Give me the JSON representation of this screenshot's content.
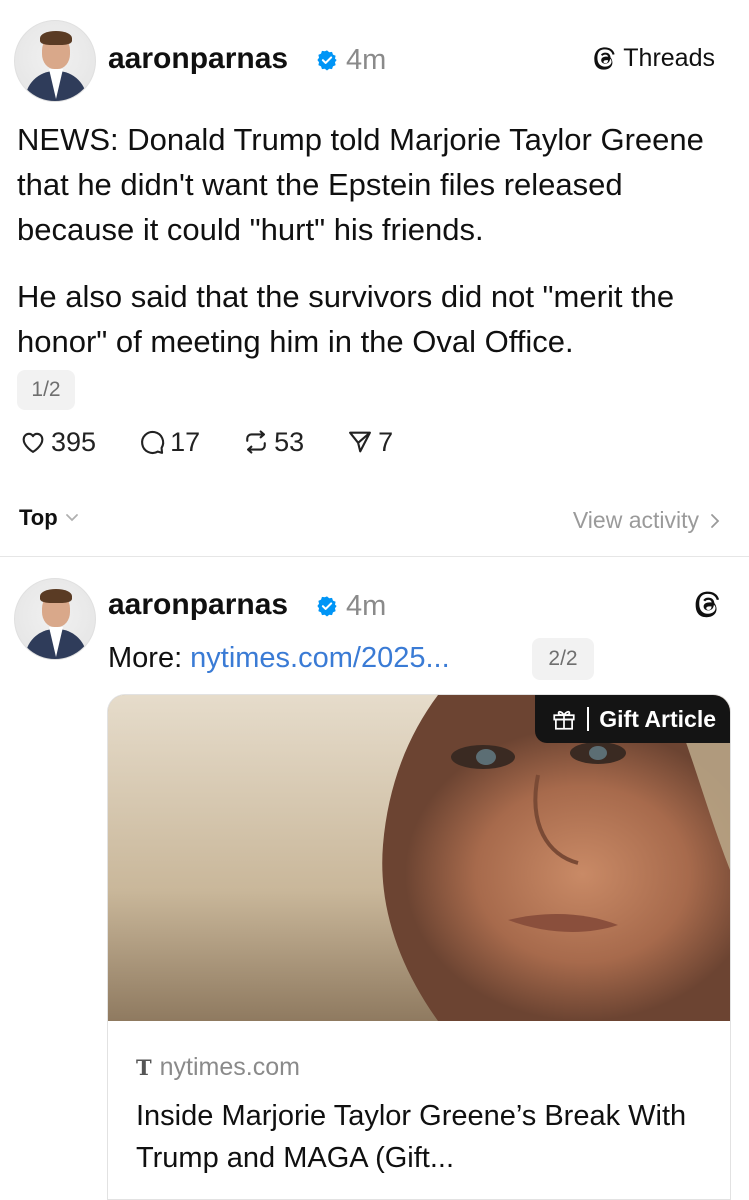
{
  "post1": {
    "username": "aaronparnas",
    "time": "4m",
    "platform_label": "Threads",
    "paragraphs": [
      "NEWS: Donald Trump told Marjorie Taylor Greene that he didn't want the Epstein files released because it could \"hurt\" his friends.",
      "He also said that the survivors did not \"merit the honor\" of meeting him in the Oval Office."
    ],
    "pager": "1/2",
    "actions": {
      "likes": "395",
      "replies": "17",
      "reposts": "53",
      "shares": "7"
    }
  },
  "sort": {
    "label": "Top",
    "view_activity": "View activity"
  },
  "post2": {
    "username": "aaronparnas",
    "time": "4m",
    "more_label": "More:",
    "link_text": "nytimes.com/2025...",
    "pager": "2/2",
    "card": {
      "gift_label": "Gift Article",
      "source_icon": "T",
      "domain": "nytimes.com",
      "title": "Inside Marjorie Taylor Greene’s Break With Trump and MAGA (Gift..."
    }
  },
  "icons": {
    "verified": "verified-badge-icon",
    "like": "heart-icon",
    "reply": "comment-icon",
    "repost": "repost-icon",
    "share": "send-icon",
    "threads": "threads-logo-icon",
    "gift": "gift-icon"
  },
  "colors": {
    "text": "#101010",
    "muted": "#8a8a8a",
    "link": "#3a7bd5",
    "verified": "#0095f6",
    "gift_badge_bg": "#141414"
  }
}
